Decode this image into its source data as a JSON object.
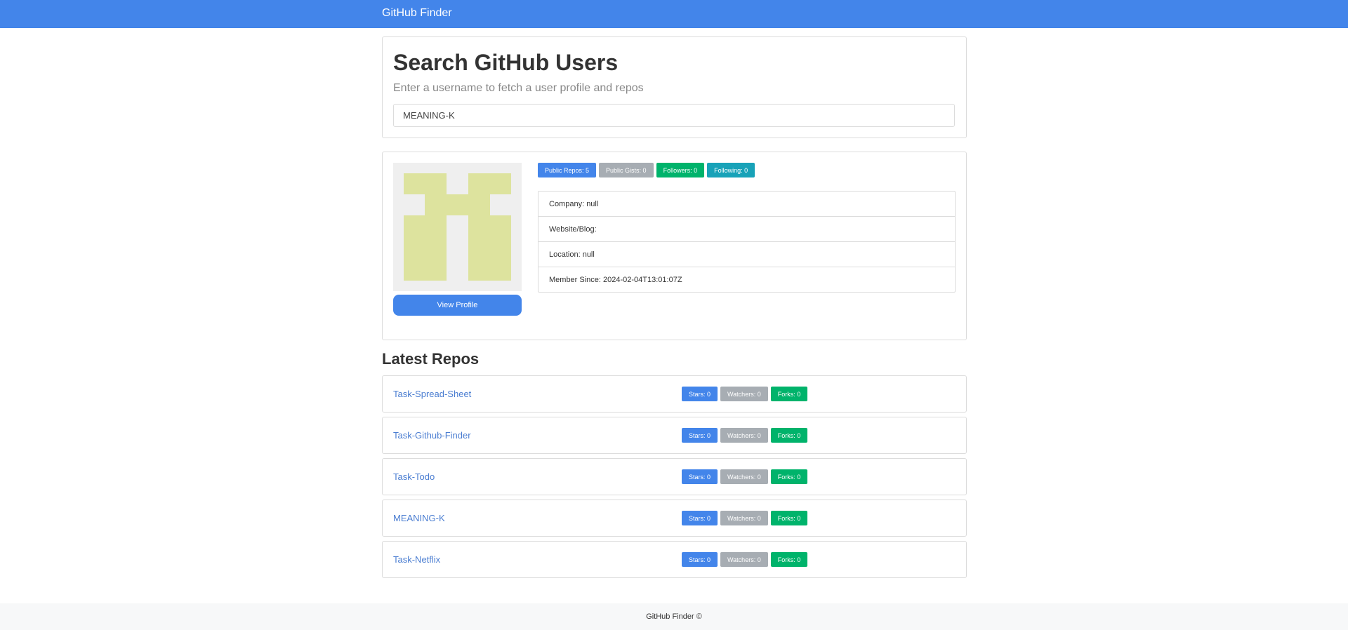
{
  "navbar": {
    "brand": "GitHub Finder"
  },
  "search": {
    "title": "Search GitHub Users",
    "subtitle": "Enter a username to fetch a user profile and repos",
    "value": "MEANING-K"
  },
  "profile": {
    "avatar_colors": {
      "background": "#efefef",
      "fill": "#dde39e"
    },
    "view_profile_label": "View Profile",
    "badges": {
      "public_repos": "Public Repos: 5",
      "public_gists": "Public Gists: 0",
      "followers": "Followers: 0",
      "following": "Following: 0"
    },
    "info": {
      "company": "Company: null",
      "website": "Website/Blog:",
      "location": "Location: null",
      "member_since": "Member Since: 2024-02-04T13:01:07Z"
    }
  },
  "repos": {
    "heading": "Latest Repos",
    "items": [
      {
        "name": "Task-Spread-Sheet",
        "stars": "Stars: 0",
        "watchers": "Watchers: 0",
        "forks": "Forks: 0"
      },
      {
        "name": "Task-Github-Finder",
        "stars": "Stars: 0",
        "watchers": "Watchers: 0",
        "forks": "Forks: 0"
      },
      {
        "name": "Task-Todo",
        "stars": "Stars: 0",
        "watchers": "Watchers: 0",
        "forks": "Forks: 0"
      },
      {
        "name": "MEANING-K",
        "stars": "Stars: 0",
        "watchers": "Watchers: 0",
        "forks": "Forks: 0"
      },
      {
        "name": "Task-Netflix",
        "stars": "Stars: 0",
        "watchers": "Watchers: 0",
        "forks": "Forks: 0"
      }
    ]
  },
  "footer": {
    "text": "GitHub Finder ©"
  },
  "colors": {
    "primary": "#4385ea",
    "secondary": "#a7adb3",
    "success": "#00b36b",
    "info": "#18a2b8",
    "link": "#4a7dd1"
  }
}
